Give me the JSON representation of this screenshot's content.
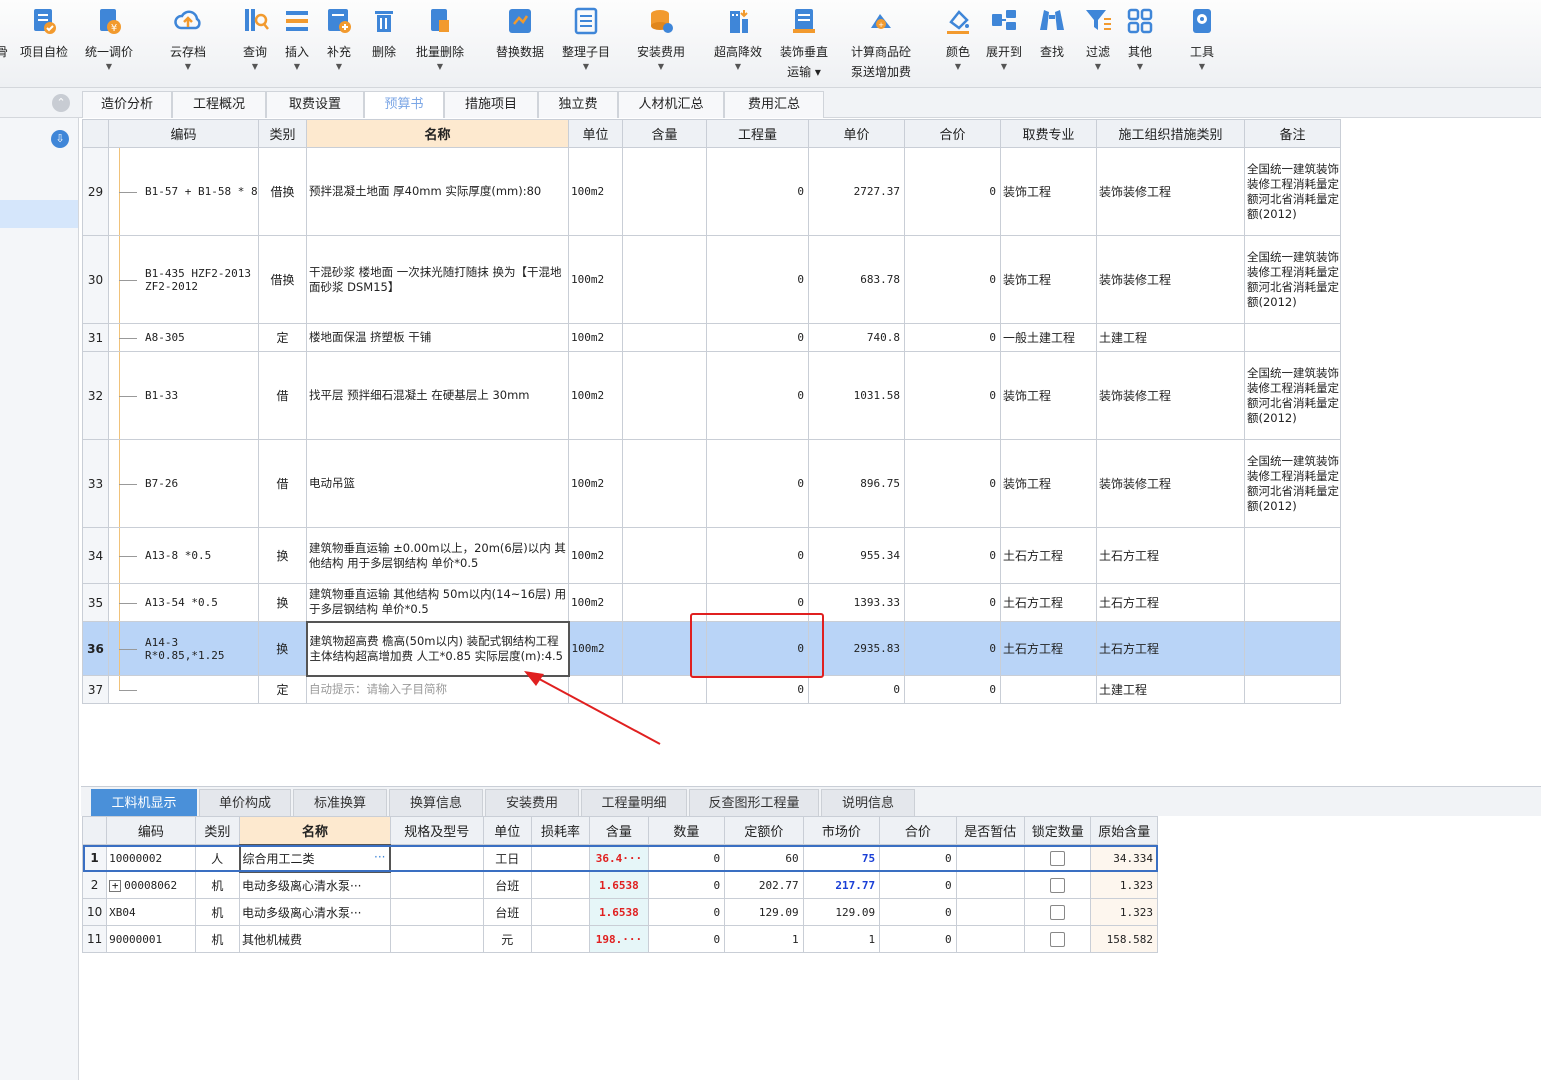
{
  "toolbar": {
    "items": [
      {
        "label": "项目自检",
        "icon": "check-doc-icon"
      },
      {
        "label": "统一调价",
        "icon": "price-adjust-icon"
      },
      {
        "label": "云存档",
        "icon": "cloud-icon"
      },
      {
        "label": "查询",
        "icon": "query-icon"
      },
      {
        "label": "插入",
        "icon": "insert-icon"
      },
      {
        "label": "补充",
        "icon": "supplement-icon"
      },
      {
        "label": "删除",
        "icon": "trash-icon"
      },
      {
        "label": "批量删除",
        "icon": "batch-delete-icon"
      },
      {
        "label": "替换数据",
        "icon": "replace-icon"
      },
      {
        "label": "整理子目",
        "icon": "organize-icon"
      },
      {
        "label": "安装费用",
        "icon": "install-fee-icon"
      },
      {
        "label": "超高降效",
        "icon": "high-rise-icon"
      },
      {
        "label": "装饰垂直",
        "label2": "运输",
        "icon": "vertical-transport-icon"
      },
      {
        "label": "计算商品砼",
        "label2": "泵送增加费",
        "icon": "pump-icon"
      },
      {
        "label": "颜色",
        "icon": "color-icon"
      },
      {
        "label": "展开到",
        "icon": "expand-icon"
      },
      {
        "label": "查找",
        "icon": "binoculars-icon"
      },
      {
        "label": "过滤",
        "icon": "filter-icon"
      },
      {
        "label": "其他",
        "icon": "grid-icon"
      },
      {
        "label": "工具",
        "icon": "tools-icon"
      }
    ]
  },
  "tabs": [
    "造价分析",
    "工程概况",
    "取费设置",
    "预算书",
    "措施项目",
    "独立费",
    "人材机汇总",
    "费用汇总"
  ],
  "main_table": {
    "headers": [
      "编码",
      "类别",
      "名称",
      "单位",
      "含量",
      "工程量",
      "单价",
      "合价",
      "取费专业",
      "施工组织措施类别",
      "备注"
    ],
    "rows": [
      {
        "no": "29",
        "code": "B1-57 + B1-58 * 8",
        "type": "借换",
        "name": "预拌混凝土地面 厚40mm  实际厚度(mm):80",
        "unit": "100m2",
        "content": "",
        "qty": "0",
        "price": "2727.37",
        "total": "0",
        "fee": "装饰工程",
        "measure": "装饰装修工程",
        "note": "全国统一建筑装饰装修工程消耗量定额河北省消耗量定额(2012)"
      },
      {
        "no": "30",
        "code": "B1-435 HZF2-2013 ZF2-2012",
        "type": "借换",
        "name": "干混砂浆 楼地面 一次抹光随打随抹  换为【干混地面砂浆 DSM15】",
        "unit": "100m2",
        "content": "",
        "qty": "0",
        "price": "683.78",
        "total": "0",
        "fee": "装饰工程",
        "measure": "装饰装修工程",
        "note": "全国统一建筑装饰装修工程消耗量定额河北省消耗量定额(2012)"
      },
      {
        "no": "31",
        "code": "A8-305",
        "type": "定",
        "name": "楼地面保温 挤塑板 干铺",
        "unit": "100m2",
        "content": "",
        "qty": "0",
        "price": "740.8",
        "total": "0",
        "fee": "一般土建工程",
        "measure": "土建工程",
        "note": ""
      },
      {
        "no": "32",
        "code": "B1-33",
        "type": "借",
        "name": "找平层 预拌细石混凝土 在硬基层上 30mm",
        "unit": "100m2",
        "content": "",
        "qty": "0",
        "price": "1031.58",
        "total": "0",
        "fee": "装饰工程",
        "measure": "装饰装修工程",
        "note": "全国统一建筑装饰装修工程消耗量定额河北省消耗量定额(2012)"
      },
      {
        "no": "33",
        "code": "B7-26",
        "type": "借",
        "name": "电动吊篮",
        "unit": "100m2",
        "content": "",
        "qty": "0",
        "price": "896.75",
        "total": "0",
        "fee": "装饰工程",
        "measure": "装饰装修工程",
        "note": "全国统一建筑装饰装修工程消耗量定额河北省消耗量定额(2012)"
      },
      {
        "no": "34",
        "code": "A13-8 *0.5",
        "type": "换",
        "name": "建筑物垂直运输 ±0.00m以上，20m(6层)以内 其他结构  用于多层钢结构 单价*0.5",
        "unit": "100m2",
        "content": "",
        "qty": "0",
        "price": "955.34",
        "total": "0",
        "fee": "土石方工程",
        "measure": "土石方工程",
        "note": ""
      },
      {
        "no": "35",
        "code": "A13-54 *0.5",
        "type": "换",
        "name": "建筑物垂直运输 其他结构 50m以内(14~16层)  用于多层钢结构 单价*0.5",
        "unit": "100m2",
        "content": "",
        "qty": "0",
        "price": "1393.33",
        "total": "0",
        "fee": "土石方工程",
        "measure": "土石方工程",
        "note": ""
      },
      {
        "no": "36",
        "code": "A14-3 R*0.85,*1.25",
        "type": "换",
        "name": "建筑物超高费 檐高(50m以内)  装配式钢结构工程主体结构超高增加费 人工*0.85  实际层度(m):4.5",
        "unit": "100m2",
        "content": "",
        "qty": "0",
        "price": "2935.83",
        "total": "0",
        "fee": "土石方工程",
        "measure": "土石方工程",
        "note": ""
      },
      {
        "no": "37",
        "code": "",
        "type": "定",
        "name": "自动提示：请输入子目简称",
        "unit": "",
        "content": "",
        "qty": "0",
        "price": "0",
        "total": "0",
        "fee": "",
        "measure": "土建工程",
        "note": ""
      }
    ]
  },
  "bottom_tabs": [
    "工料机显示",
    "单价构成",
    "标准换算",
    "换算信息",
    "安装费用",
    "工程量明细",
    "反查图形工程量",
    "说明信息"
  ],
  "sub_table": {
    "headers": [
      "编码",
      "类别",
      "名称",
      "规格及型号",
      "单位",
      "损耗率",
      "含量",
      "数量",
      "定额价",
      "市场价",
      "合价",
      "是否暂估",
      "锁定数量",
      "原始含量"
    ],
    "rows": [
      {
        "no": "1",
        "code": "10000002",
        "type": "人",
        "name": "综合用工二类",
        "spec": "",
        "unit": "工日",
        "loss": "",
        "content": "36.4···",
        "amount": "0",
        "quota": "60",
        "market": "75",
        "total": "0",
        "est": "",
        "orig": "34.334"
      },
      {
        "no": "2",
        "code": "00008062",
        "type": "机",
        "name": "电动多级离心清水泵···",
        "spec": "",
        "unit": "台班",
        "loss": "",
        "content": "1.6538",
        "amount": "0",
        "quota": "202.77",
        "market": "217.77",
        "total": "0",
        "est": "",
        "orig": "1.323"
      },
      {
        "no": "10",
        "code": "XB04",
        "type": "机",
        "name": "电动多级离心清水泵···",
        "spec": "",
        "unit": "台班",
        "loss": "",
        "content": "1.6538",
        "amount": "0",
        "quota": "129.09",
        "market": "129.09",
        "total": "0",
        "est": "",
        "orig": "1.323"
      },
      {
        "no": "11",
        "code": "90000001",
        "type": "机",
        "name": "其他机械费",
        "spec": "",
        "unit": "元",
        "loss": "",
        "content": "198.···",
        "amount": "0",
        "quota": "1",
        "market": "1",
        "total": "0",
        "est": "",
        "orig": "158.582"
      }
    ]
  },
  "colors": {
    "accent": "#4a90d9",
    "selected_row": "#b9d4f7",
    "highlight_box": "#e02020",
    "header_active": "#fde9cf"
  }
}
